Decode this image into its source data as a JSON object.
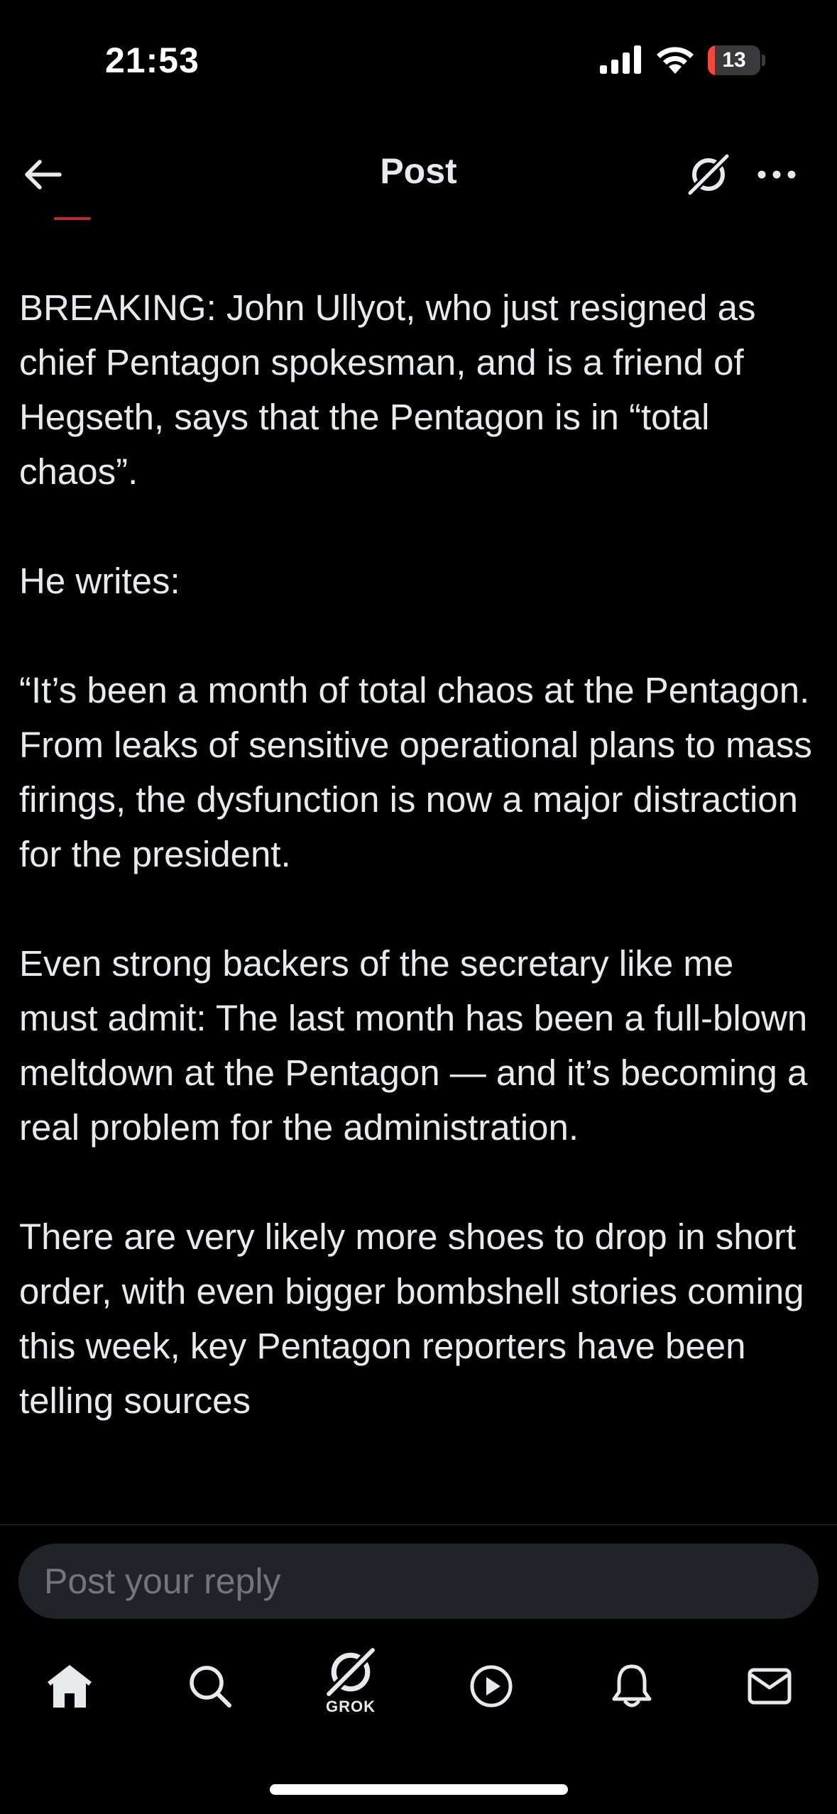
{
  "status_bar": {
    "time": "21:53",
    "battery_text": "13",
    "battery_level": 0.13
  },
  "header": {
    "title": "Post"
  },
  "post": {
    "paragraphs": [
      "BREAKING: John Ullyot, who just resigned as chief Pentagon spokesman, and is a friend of Hegseth, says that the Pentagon is in “total chaos”.",
      "He writes:",
      "“It’s been a month of total chaos at the Pentagon. From leaks of sensitive operational plans to mass firings, the dysfunction is now a major distraction for the president.",
      "Even strong backers of the secretary like me must admit: The last month has been a full-blown meltdown at the Pentagon — and it’s becoming a real problem for the administration.",
      "There are very likely more shoes to drop in short order, with even bigger bombshell stories coming this week, key Pentagon reporters have been telling sources"
    ]
  },
  "reply": {
    "placeholder": "Post your reply"
  },
  "tab_bar": {
    "grok_label": "GROK"
  },
  "colors": {
    "background": "#000000",
    "text": "#e7e9ea",
    "muted": "#71767b",
    "input_bg": "#202327",
    "battery_low": "#ff453a"
  }
}
